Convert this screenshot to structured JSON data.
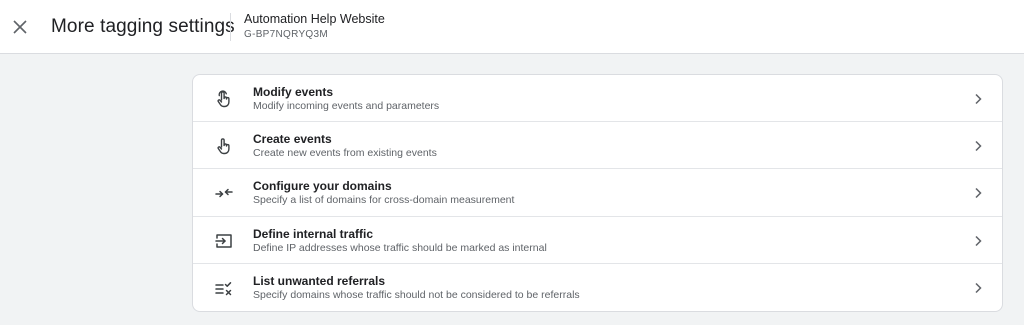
{
  "header": {
    "title": "More tagging settings",
    "property_name": "Automation Help Website",
    "property_id": "G-BP7NQRYQ3M"
  },
  "settings": [
    {
      "title": "Modify events",
      "description": "Modify incoming events and parameters",
      "icon": "touch-icon"
    },
    {
      "title": "Create events",
      "description": "Create new events from existing events",
      "icon": "touch-icon"
    },
    {
      "title": "Configure your domains",
      "description": "Specify a list of domains for cross-domain measurement",
      "icon": "merge-arrows-icon"
    },
    {
      "title": "Define internal traffic",
      "description": "Define IP addresses whose traffic should be marked as internal",
      "icon": "input-icon"
    },
    {
      "title": "List unwanted referrals",
      "description": "Specify domains whose traffic should not be considered to be referrals",
      "icon": "checklist-x-icon"
    }
  ]
}
